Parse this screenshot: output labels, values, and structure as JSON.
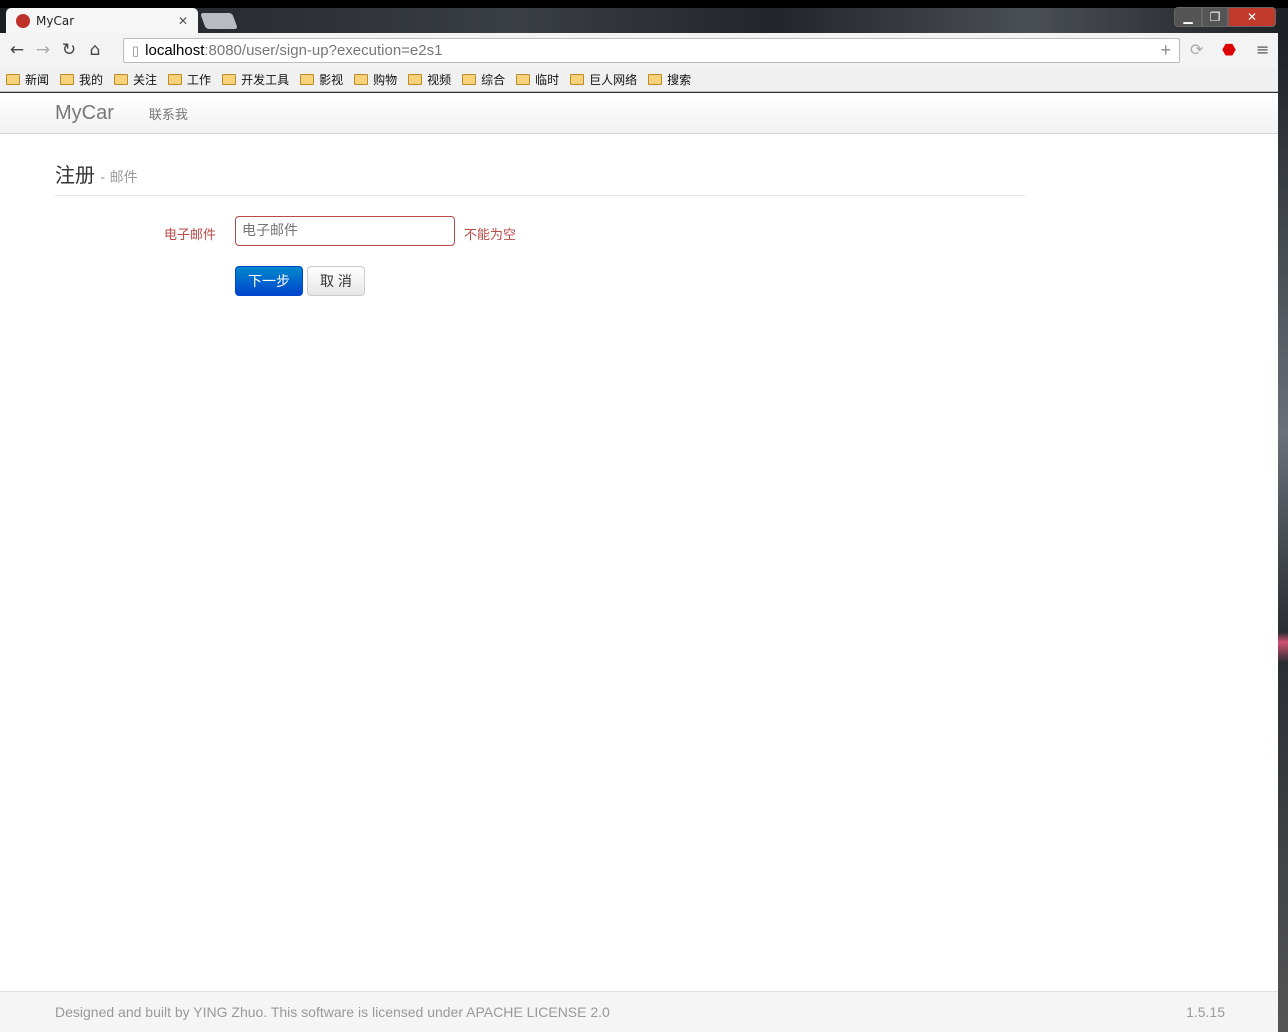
{
  "browser": {
    "tab_title": "MyCar",
    "url_host": "localhost",
    "url_rest": ":8080/user/sign-up?execution=e2s1",
    "bookmarks": [
      "新闻",
      "我的",
      "关注",
      "工作",
      "开发工具",
      "影视",
      "购物",
      "视频",
      "综合",
      "临时",
      "巨人网络",
      "搜索"
    ]
  },
  "navbar": {
    "brand": "MyCar",
    "links": [
      "联系我"
    ]
  },
  "page": {
    "title": "注册",
    "subtitle": "- 邮件"
  },
  "form": {
    "email_label": "电子邮件",
    "email_placeholder": "电子邮件",
    "email_value": "",
    "email_error": "不能为空",
    "next_label": "下一步",
    "cancel_label": "取 消",
    "error_color": "#b94a48",
    "primary_color": "#0055cc"
  },
  "footer": {
    "text": "Designed and built by YING Zhuo. This software is licensed under APACHE LICENSE 2.0",
    "version": "1.5.15"
  }
}
